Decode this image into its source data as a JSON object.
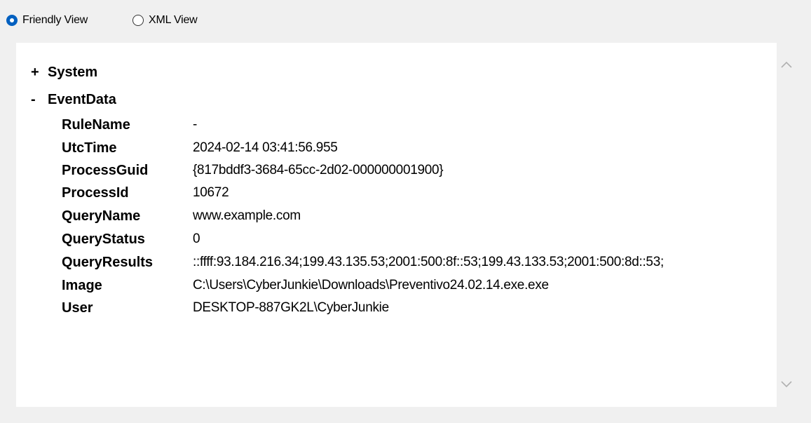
{
  "view_options": {
    "friendly": {
      "label": "Friendly View",
      "selected": true
    },
    "xml": {
      "label": "XML View",
      "selected": false
    }
  },
  "tree": {
    "system": {
      "toggle": "+",
      "label": "System"
    },
    "event_data": {
      "toggle": "-",
      "label": "EventData"
    }
  },
  "fields": [
    {
      "key": "RuleName",
      "value": "-"
    },
    {
      "key": "UtcTime",
      "value": "2024-02-14 03:41:56.955"
    },
    {
      "key": "ProcessGuid",
      "value": "{817bddf3-3684-65cc-2d02-000000001900}"
    },
    {
      "key": "ProcessId",
      "value": "10672"
    },
    {
      "key": "QueryName",
      "value": "www.example.com"
    },
    {
      "key": "QueryStatus",
      "value": "0"
    },
    {
      "key": "QueryResults",
      "value": "::ffff:93.184.216.34;199.43.135.53;2001:500:8f::53;199.43.133.53;2001:500:8d::53;"
    },
    {
      "key": "Image",
      "value": "C:\\Users\\CyberJunkie\\Downloads\\Preventivo24.02.14.exe.exe"
    },
    {
      "key": "User",
      "value": "DESKTOP-887GK2L\\CyberJunkie"
    }
  ],
  "icons": {
    "scroll_up": "chevron-up-icon",
    "scroll_down": "chevron-down-icon"
  },
  "colors": {
    "accent": "#0060c0",
    "background": "#f0f0f0",
    "panel": "#ffffff"
  }
}
